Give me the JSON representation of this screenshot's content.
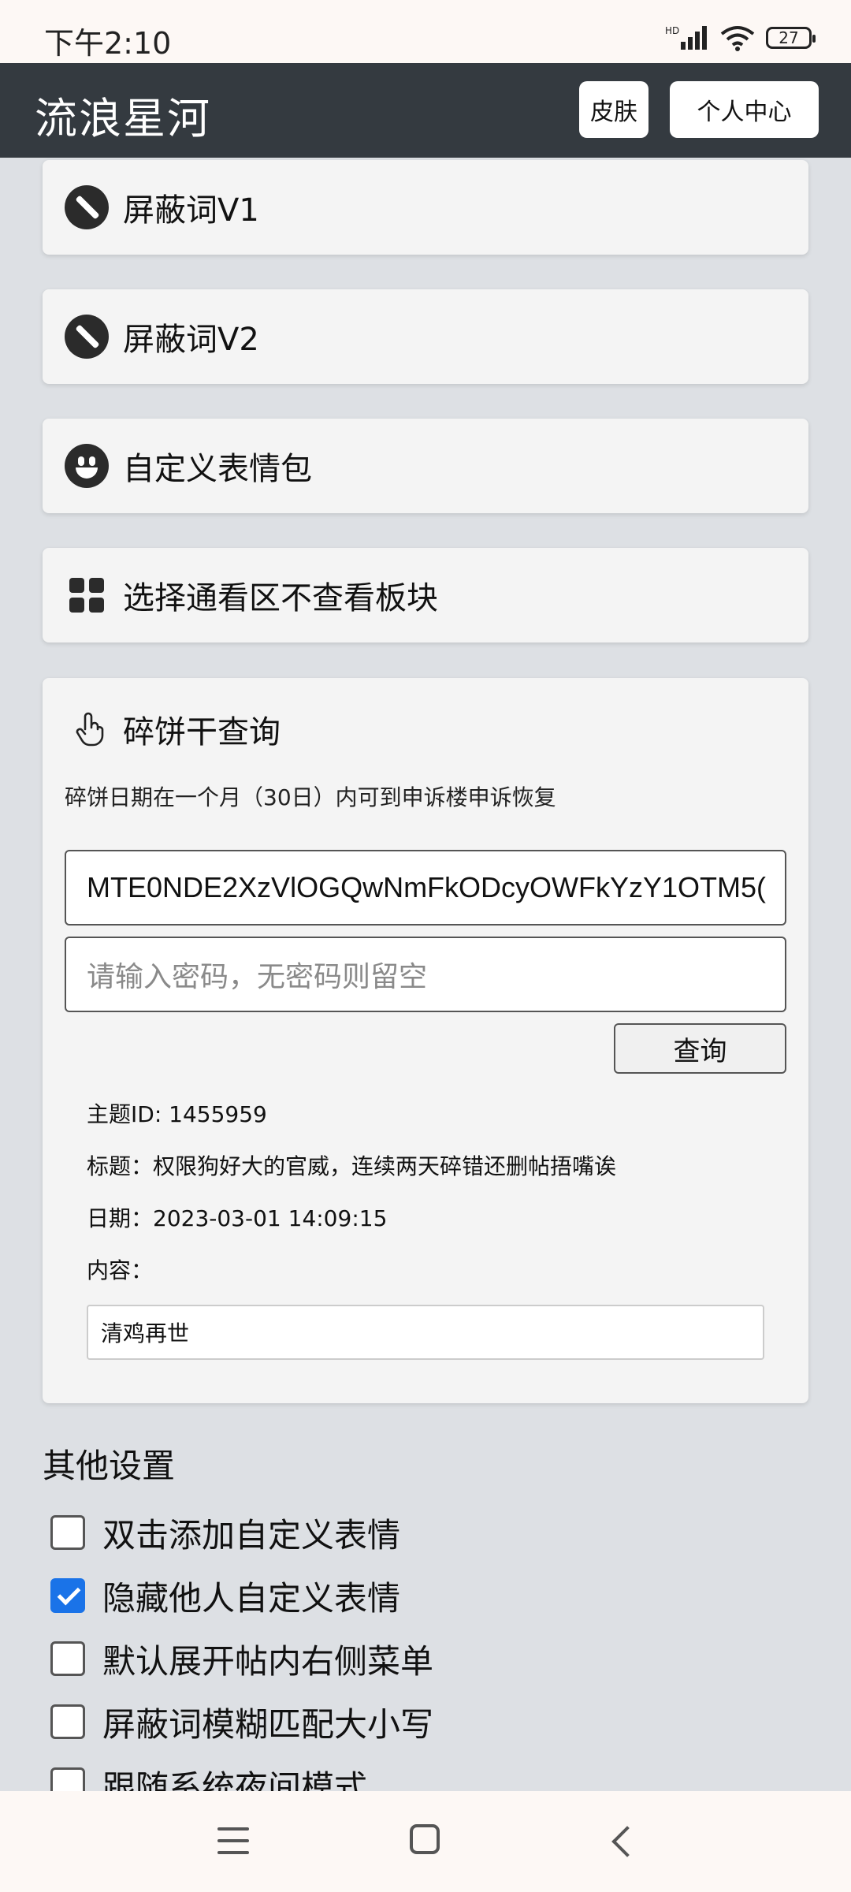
{
  "status_bar": {
    "time": "下午2:10",
    "network_label": "HD",
    "battery": "27"
  },
  "header": {
    "title": "流浪星河",
    "skin_button": "皮肤",
    "profile_button": "个人中心"
  },
  "menu_cards": [
    {
      "icon": "ban-icon",
      "label": "屏蔽词V1"
    },
    {
      "icon": "ban-icon",
      "label": "屏蔽词V2"
    },
    {
      "icon": "smile-icon",
      "label": "自定义表情包"
    },
    {
      "icon": "grid-icon",
      "label": "选择通看区不查看板块"
    }
  ],
  "cookie_query": {
    "title": "碎饼干查询",
    "icon": "pointer-hand-icon",
    "note": "碎饼日期在一个月（30日）内可到申诉楼申诉恢复",
    "token_value": "MTE0NDE2XzVlOGQwNmFkODcyOWFkYzY1OTM5(",
    "password_placeholder": "请输入密码，无密码则留空",
    "query_button": "查询",
    "result": {
      "topic_id": "主题ID: 1455959",
      "title": "标题：权限狗好大的官威，连续两天碎错还删帖捂嘴诶",
      "date": "日期：2023-03-01 14:09:15",
      "content_label": "内容：",
      "content_value": "清鸡再世"
    }
  },
  "other_settings": {
    "title": "其他设置",
    "options": [
      {
        "label": "双击添加自定义表情",
        "checked": false
      },
      {
        "label": "隐藏他人自定义表情",
        "checked": true
      },
      {
        "label": "默认展开帖内右侧菜单",
        "checked": false
      },
      {
        "label": "屏蔽词模糊匹配大小写",
        "checked": false
      },
      {
        "label": "跟随系统夜间模式",
        "checked": false
      }
    ]
  },
  "nav_bar": {
    "icons": [
      "menu-icon",
      "home-icon",
      "back-icon"
    ]
  }
}
